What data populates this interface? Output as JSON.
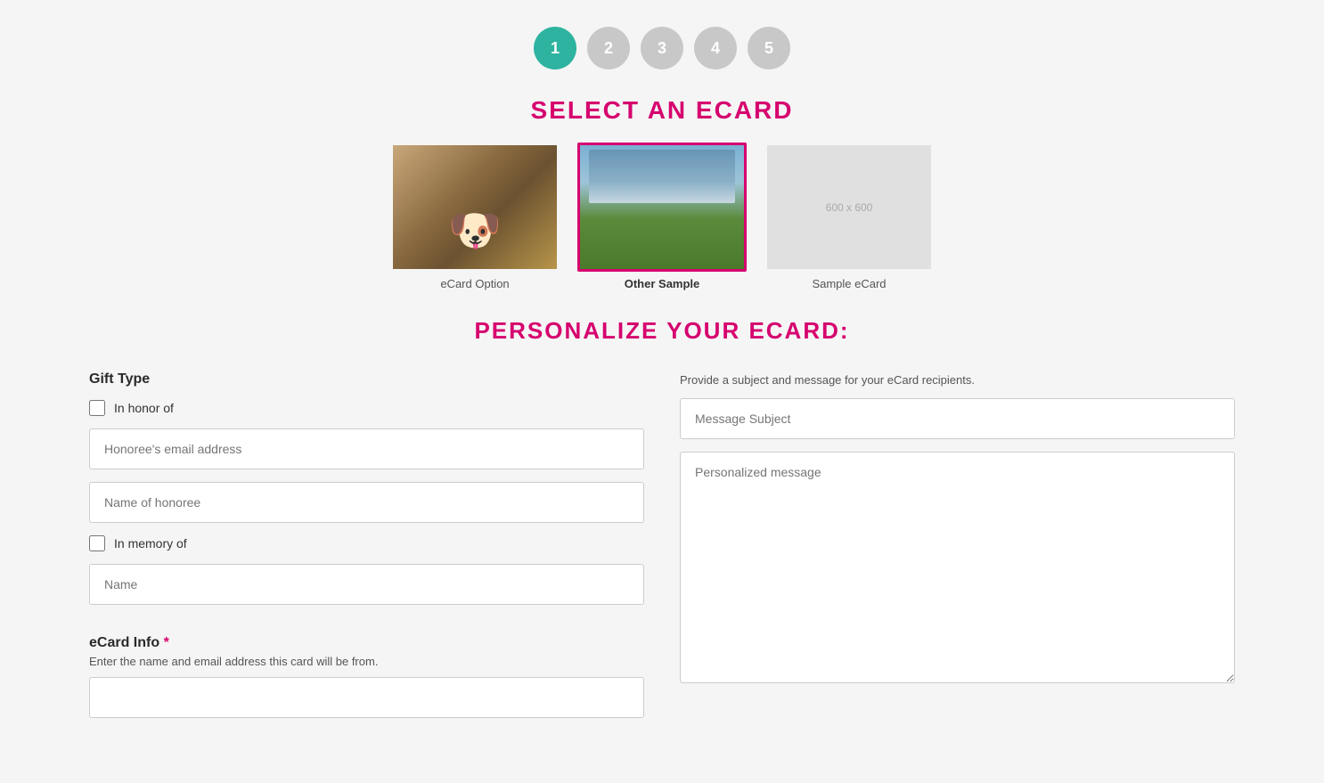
{
  "steps": [
    {
      "number": "1",
      "state": "active"
    },
    {
      "number": "2",
      "state": "inactive"
    },
    {
      "number": "3",
      "state": "inactive"
    },
    {
      "number": "4",
      "state": "inactive"
    },
    {
      "number": "5",
      "state": "inactive"
    }
  ],
  "select_ecard": {
    "title": "SELECT AN ECARD",
    "cards": [
      {
        "id": "ecard-option",
        "label": "eCard Option",
        "selected": false,
        "type": "dog"
      },
      {
        "id": "other-sample",
        "label": "Other Sample",
        "selected": true,
        "type": "landscape"
      },
      {
        "id": "sample-ecard",
        "label": "Sample eCard",
        "selected": false,
        "type": "placeholder",
        "placeholder_text": "600 x 600"
      }
    ]
  },
  "personalize": {
    "title": "PERSONALIZE YOUR ECARD:",
    "left": {
      "gift_type_label": "Gift Type",
      "in_honor_label": "In honor of",
      "honoree_email_placeholder": "Honoree's email address",
      "name_of_honoree_placeholder": "Name of honoree",
      "in_memory_label": "In memory of",
      "name_placeholder": "Name",
      "ecard_info_label": "eCard Info",
      "required_marker": "*",
      "ecard_info_subtitle": "Enter the name and email address this card will be from."
    },
    "right": {
      "provide_text_1": "Provide a ",
      "provide_subject": "subject",
      "provide_text_2": " and message ",
      "provide_for": "for",
      "provide_text_3": " your eCard recipients.",
      "message_subject_placeholder": "Message Subject",
      "personalized_message_placeholder": "Personalized message"
    }
  }
}
